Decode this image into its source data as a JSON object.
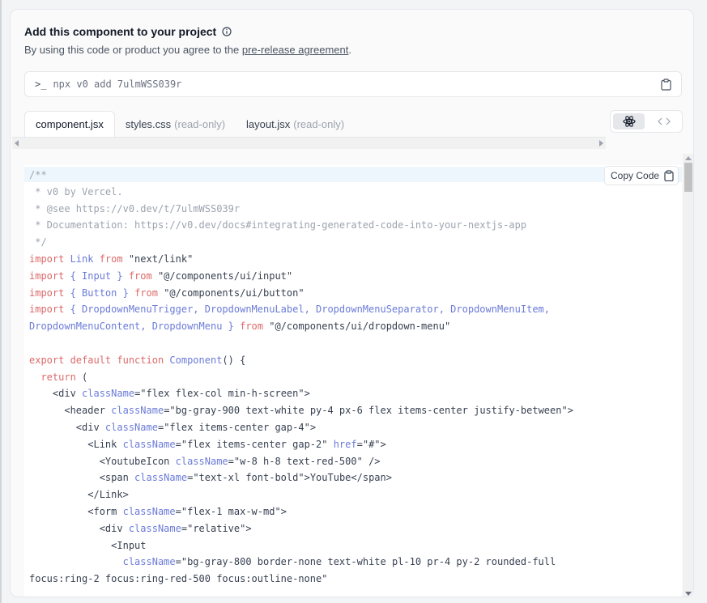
{
  "header": {
    "title": "Add this component to your project",
    "subtitle_prefix": "By using this code or product you agree to the ",
    "subtitle_link": "pre-release agreement",
    "subtitle_suffix": "."
  },
  "command": {
    "prompt": ">_",
    "text": "npx v0 add 7ulmWSS039r"
  },
  "tabs": [
    {
      "label": "component.jsx",
      "suffix": ""
    },
    {
      "label": "styles.css",
      "suffix": "(read-only)"
    },
    {
      "label": "layout.jsx",
      "suffix": "(read-only)"
    }
  ],
  "copy_button": {
    "label": "Copy Code"
  },
  "colors": {
    "keyword": "#dc6a6a",
    "identifier": "#6b7bd8",
    "comment": "#9ca3af"
  },
  "code_lines": [
    [
      [
        "cm",
        "/**"
      ]
    ],
    [
      [
        "cm",
        " * v0 by Vercel."
      ]
    ],
    [
      [
        "cm",
        " * @see https://v0.dev/t/7ulmWSS039r"
      ]
    ],
    [
      [
        "cm",
        " * Documentation: https://v0.dev/docs#integrating-generated-code-into-your-nextjs-app"
      ]
    ],
    [
      [
        "cm",
        " */"
      ]
    ],
    [
      [
        "kw",
        "import "
      ],
      [
        "id",
        "Link "
      ],
      [
        "kw",
        "from "
      ],
      [
        "st",
        "\"next/link\""
      ]
    ],
    [
      [
        "kw",
        "import "
      ],
      [
        "id",
        "{ Input } "
      ],
      [
        "kw",
        "from "
      ],
      [
        "st",
        "\"@/components/ui/input\""
      ]
    ],
    [
      [
        "kw",
        "import "
      ],
      [
        "id",
        "{ Button } "
      ],
      [
        "kw",
        "from "
      ],
      [
        "st",
        "\"@/components/ui/button\""
      ]
    ],
    [
      [
        "kw",
        "import "
      ],
      [
        "id",
        "{ DropdownMenuTrigger, DropdownMenuLabel, DropdownMenuSeparator, DropdownMenuItem,"
      ]
    ],
    [
      [
        "id",
        "DropdownMenuContent, DropdownMenu } "
      ],
      [
        "kw",
        "from "
      ],
      [
        "st",
        "\"@/components/ui/dropdown-menu\""
      ]
    ],
    [
      [
        "pl",
        ""
      ]
    ],
    [
      [
        "kw",
        "export default function "
      ],
      [
        "id",
        "Component"
      ],
      [
        "pl",
        "() {"
      ]
    ],
    [
      [
        "kw",
        "  return "
      ],
      [
        "pl",
        "("
      ]
    ],
    [
      [
        "pl",
        "    <div "
      ],
      [
        "id",
        "className"
      ],
      [
        "pl",
        "="
      ],
      [
        "st",
        "\"flex flex-col min-h-screen\""
      ],
      [
        "pl",
        ">"
      ]
    ],
    [
      [
        "pl",
        "      <header "
      ],
      [
        "id",
        "className"
      ],
      [
        "pl",
        "="
      ],
      [
        "st",
        "\"bg-gray-900 text-white py-4 px-6 flex items-center justify-between\""
      ],
      [
        "pl",
        ">"
      ]
    ],
    [
      [
        "pl",
        "        <div "
      ],
      [
        "id",
        "className"
      ],
      [
        "pl",
        "="
      ],
      [
        "st",
        "\"flex items-center gap-4\""
      ],
      [
        "pl",
        ">"
      ]
    ],
    [
      [
        "pl",
        "          <Link "
      ],
      [
        "id",
        "className"
      ],
      [
        "pl",
        "="
      ],
      [
        "st",
        "\"flex items-center gap-2\" "
      ],
      [
        "id",
        "href"
      ],
      [
        "pl",
        "="
      ],
      [
        "st",
        "\"#\""
      ],
      [
        "pl",
        ">"
      ]
    ],
    [
      [
        "pl",
        "            <YoutubeIcon "
      ],
      [
        "id",
        "className"
      ],
      [
        "pl",
        "="
      ],
      [
        "st",
        "\"w-8 h-8 text-red-500\""
      ],
      [
        "pl",
        " />"
      ]
    ],
    [
      [
        "pl",
        "            <span "
      ],
      [
        "id",
        "className"
      ],
      [
        "pl",
        "="
      ],
      [
        "st",
        "\"text-xl font-bold\""
      ],
      [
        "pl",
        ">YouTube</span>"
      ]
    ],
    [
      [
        "pl",
        "          </Link>"
      ]
    ],
    [
      [
        "pl",
        "          <form "
      ],
      [
        "id",
        "className"
      ],
      [
        "pl",
        "="
      ],
      [
        "st",
        "\"flex-1 max-w-md\""
      ],
      [
        "pl",
        ">"
      ]
    ],
    [
      [
        "pl",
        "            <div "
      ],
      [
        "id",
        "className"
      ],
      [
        "pl",
        "="
      ],
      [
        "st",
        "\"relative\""
      ],
      [
        "pl",
        ">"
      ]
    ],
    [
      [
        "pl",
        "              <Input"
      ]
    ],
    [
      [
        "pl",
        "                "
      ],
      [
        "id",
        "className"
      ],
      [
        "pl",
        "="
      ],
      [
        "st",
        "\"bg-gray-800 border-none text-white pl-10 pr-4 py-2 rounded-full"
      ]
    ],
    [
      [
        "st",
        "focus:ring-2 focus:ring-red-500 focus:outline-none\""
      ]
    ]
  ]
}
